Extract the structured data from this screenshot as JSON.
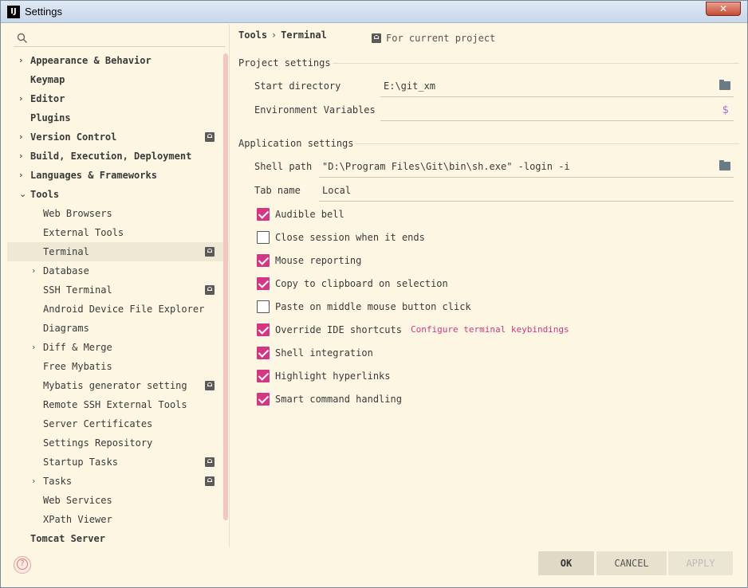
{
  "window": {
    "title": "Settings",
    "icon_text": "IJ"
  },
  "search": {
    "placeholder": ""
  },
  "tree": {
    "items": [
      {
        "label": "Appearance & Behavior",
        "level": 0,
        "arrow": "›",
        "project_icon": false
      },
      {
        "label": "Keymap",
        "level": 0,
        "arrow": "",
        "project_icon": false
      },
      {
        "label": "Editor",
        "level": 0,
        "arrow": "›",
        "project_icon": false
      },
      {
        "label": "Plugins",
        "level": 0,
        "arrow": "",
        "project_icon": false
      },
      {
        "label": "Version Control",
        "level": 0,
        "arrow": "›",
        "project_icon": true
      },
      {
        "label": "Build, Execution, Deployment",
        "level": 0,
        "arrow": "›",
        "project_icon": false
      },
      {
        "label": "Languages & Frameworks",
        "level": 0,
        "arrow": "›",
        "project_icon": false
      },
      {
        "label": "Tools",
        "level": 0,
        "arrow": "⌄",
        "project_icon": false
      },
      {
        "label": "Web Browsers",
        "level": 1,
        "arrow": "",
        "project_icon": false
      },
      {
        "label": "External Tools",
        "level": 1,
        "arrow": "",
        "project_icon": false
      },
      {
        "label": "Terminal",
        "level": 1,
        "arrow": "",
        "project_icon": true,
        "selected": true
      },
      {
        "label": "Database",
        "level": 1,
        "arrow": "›",
        "project_icon": false
      },
      {
        "label": "SSH Terminal",
        "level": 1,
        "arrow": "",
        "project_icon": true
      },
      {
        "label": "Android Device File Explorer",
        "level": 1,
        "arrow": "",
        "project_icon": false
      },
      {
        "label": "Diagrams",
        "level": 1,
        "arrow": "",
        "project_icon": false
      },
      {
        "label": "Diff & Merge",
        "level": 1,
        "arrow": "›",
        "project_icon": false
      },
      {
        "label": "Free Mybatis",
        "level": 1,
        "arrow": "",
        "project_icon": false
      },
      {
        "label": "Mybatis generator setting",
        "level": 1,
        "arrow": "",
        "project_icon": true
      },
      {
        "label": "Remote SSH External Tools",
        "level": 1,
        "arrow": "",
        "project_icon": false
      },
      {
        "label": "Server Certificates",
        "level": 1,
        "arrow": "",
        "project_icon": false
      },
      {
        "label": "Settings Repository",
        "level": 1,
        "arrow": "",
        "project_icon": false
      },
      {
        "label": "Startup Tasks",
        "level": 1,
        "arrow": "",
        "project_icon": true
      },
      {
        "label": "Tasks",
        "level": 1,
        "arrow": "›",
        "project_icon": true
      },
      {
        "label": "Web Services",
        "level": 1,
        "arrow": "",
        "project_icon": false
      },
      {
        "label": "XPath Viewer",
        "level": 1,
        "arrow": "",
        "project_icon": false
      },
      {
        "label": "Tomcat Server",
        "level": 0,
        "arrow": "",
        "project_icon": false
      }
    ]
  },
  "breadcrumb": {
    "parent": "Tools",
    "separator": "›",
    "current": "Terminal"
  },
  "scope_label": "For current project",
  "project_settings": {
    "title": "Project settings",
    "start_directory_label": "Start directory",
    "start_directory_value": "E:\\git_xm",
    "env_vars_label": "Environment Variables",
    "env_vars_value": "",
    "env_vars_icon": "$"
  },
  "application_settings": {
    "title": "Application settings",
    "shell_path_label": "Shell path",
    "shell_path_value": "\"D:\\Program Files\\Git\\bin\\sh.exe\" -login -i",
    "tab_name_label": "Tab name",
    "tab_name_value": "Local"
  },
  "options": [
    {
      "label": "Audible bell",
      "checked": true
    },
    {
      "label": "Close session when it ends",
      "checked": false
    },
    {
      "label": "Mouse reporting",
      "checked": true
    },
    {
      "label": "Copy to clipboard on selection",
      "checked": true
    },
    {
      "label": "Paste on middle mouse button click",
      "checked": false
    },
    {
      "label": "Override IDE shortcuts",
      "checked": true,
      "link": "Configure terminal keybindings"
    },
    {
      "label": "Shell integration",
      "checked": true
    },
    {
      "label": "Highlight hyperlinks",
      "checked": true
    },
    {
      "label": "Smart command handling",
      "checked": true
    }
  ],
  "footer": {
    "help_glyph": "?",
    "ok_label": "OK",
    "cancel_label": "CANCEL",
    "apply_label": "APPLY"
  },
  "colors": {
    "accent": "#d33682",
    "background": "#fdf6e3",
    "selection": "#eee8d5"
  }
}
